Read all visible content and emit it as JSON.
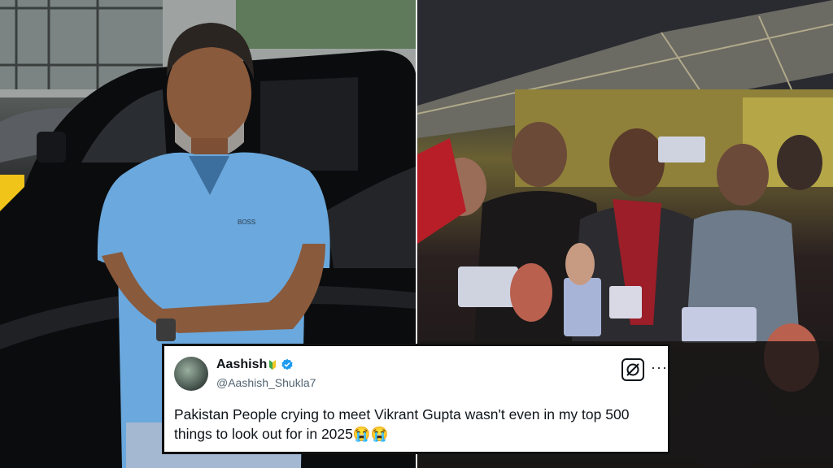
{
  "tweet": {
    "display_name": "Aashish",
    "handle": "@Aashish_Shukla7",
    "text": "Pakistan People crying to meet Vikrant Gupta wasn't even in my top 500 things to look out for in 2025😭😭",
    "icons": {
      "badge": "sprout-badge-icon",
      "verified": "verified-check-icon",
      "grok": "grok-icon",
      "more": "more-options-icon"
    },
    "colors": {
      "verified": "#1d9bf0",
      "text": "#0f1419",
      "handle": "#536471"
    }
  },
  "left_photo": {
    "shirt_text": "BOSS"
  }
}
